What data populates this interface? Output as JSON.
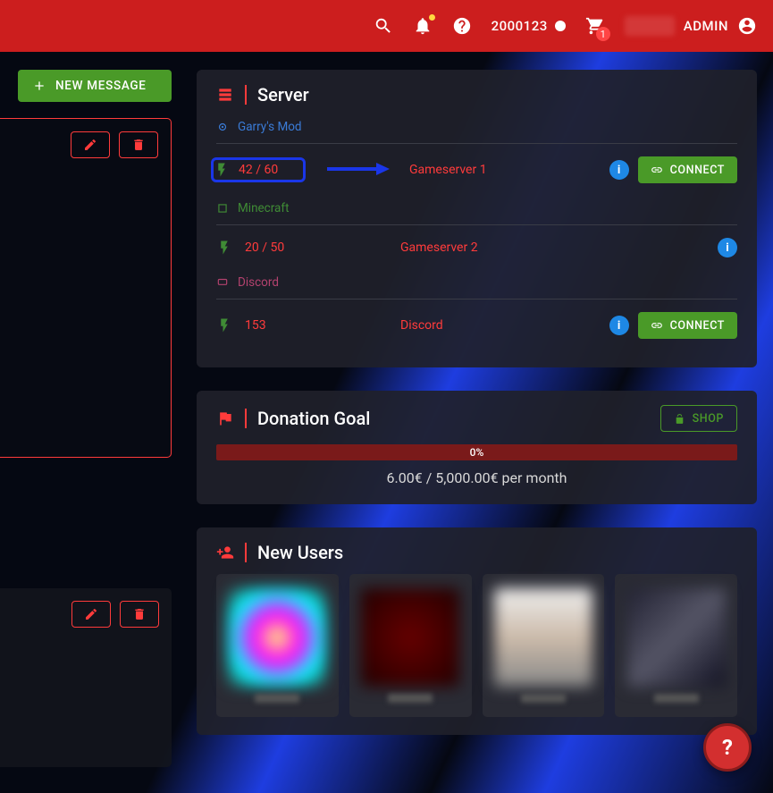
{
  "topbar": {
    "points": "2000123",
    "cart_badge": "1",
    "role": "ADMIN"
  },
  "newmsg_label": "NEW MESSAGE",
  "server_panel": {
    "title": "Server",
    "categories": {
      "gmod": "Garry's Mod",
      "minecraft": "Minecraft",
      "discord": "Discord"
    },
    "servers": {
      "s1": {
        "count": "42 / 60",
        "name": "Gameserver 1"
      },
      "s2": {
        "count": "20 / 50",
        "name": "Gameserver 2"
      },
      "s3": {
        "count": "153",
        "name": "Discord"
      }
    },
    "connect_label": "CONNECT"
  },
  "donation_panel": {
    "title": "Donation Goal",
    "shop_label": "SHOP",
    "percent": "0%",
    "text": "6.00€ / 5,000.00€ per month"
  },
  "users_panel": {
    "title": "New Users"
  }
}
